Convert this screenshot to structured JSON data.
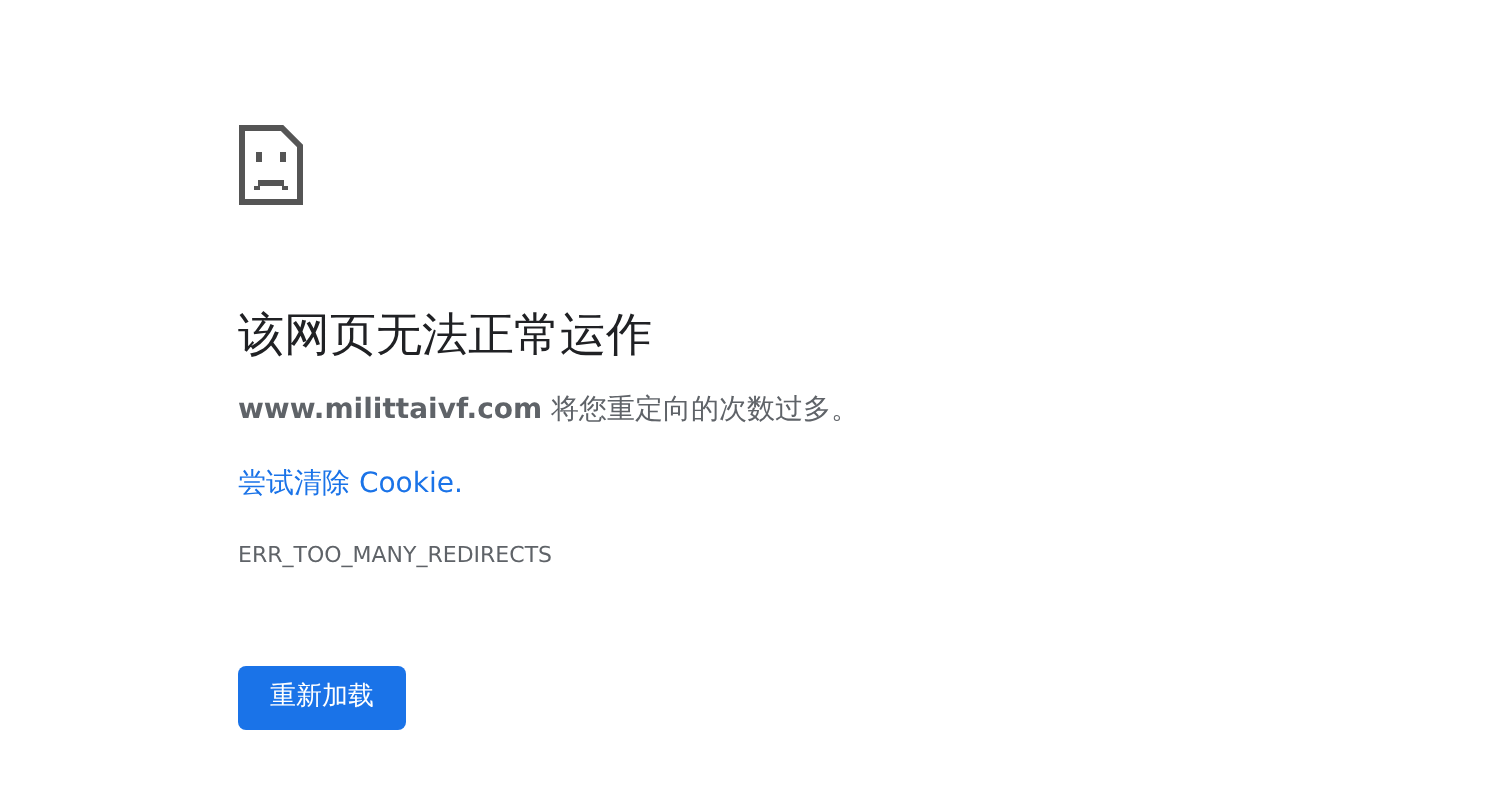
{
  "heading": "该网页无法正常运作",
  "message": "**www.milittaivf.com** 将您重定向的次数过多。",
  "suggestion_link": "尝试清除 Cookie.",
  "error_code": "ERR_TOO_MANY_REDIRECTS",
  "reload_button": "重新加载"
}
